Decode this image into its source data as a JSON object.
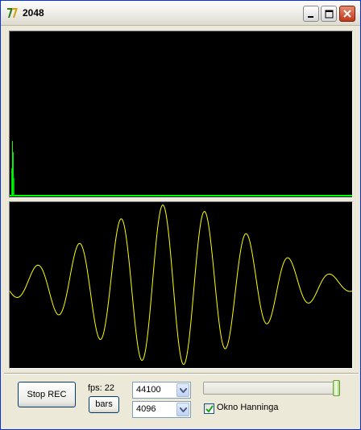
{
  "window": {
    "title": "2048",
    "icon": "app-logo-icon",
    "controls": [
      "minimize-icon",
      "maximize-icon",
      "close-icon"
    ]
  },
  "spectrum": {
    "background": "#000000",
    "color": "#00ff00"
  },
  "waveform": {
    "background": "#000000",
    "color": "#ffff00"
  },
  "controls": {
    "stop_rec_label": "Stop REC",
    "fps_label": "fps: 22",
    "bars_label": "bars",
    "sample_rate": "44100",
    "fft_size": "4096",
    "slider_level": 1.0,
    "hanning_label": "Okno Hanninga",
    "hanning_checked": true
  }
}
